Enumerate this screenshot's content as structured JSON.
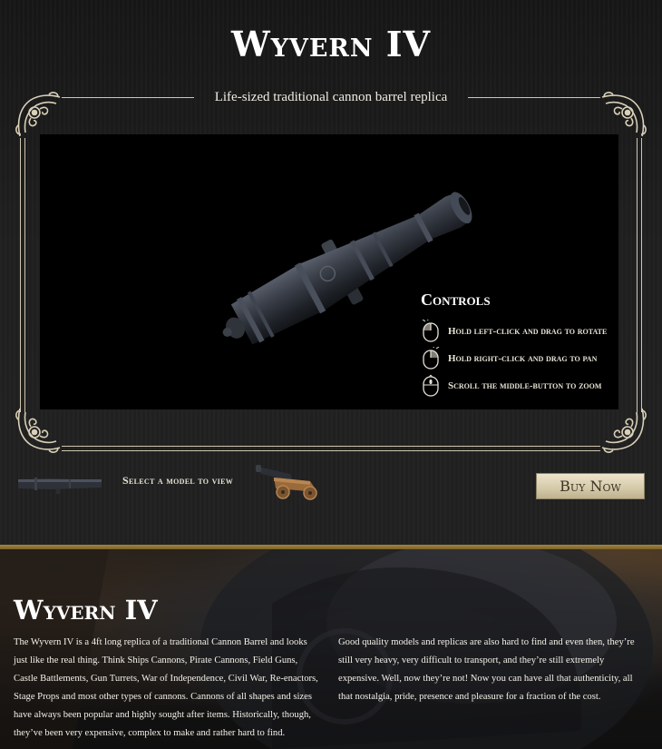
{
  "header": {
    "title": "Wyvern IV",
    "subtitle": "Life-sized traditional cannon barrel replica"
  },
  "viewer": {
    "controls_title": "Controls",
    "controls": [
      {
        "icon": "mouse-left-click-icon",
        "label": "Hold left-click and drag to rotate"
      },
      {
        "icon": "mouse-right-click-icon",
        "label": "Hold right-click and drag to pan"
      },
      {
        "icon": "mouse-scroll-icon",
        "label": "Scroll the middle-button to zoom"
      }
    ]
  },
  "model_selector": {
    "label": "Select a model to view",
    "models": [
      {
        "name": "cannon-barrel-thumbnail"
      },
      {
        "name": "cannon-carriage-thumbnail"
      }
    ]
  },
  "buy_button": {
    "label": "Buy Now"
  },
  "description": {
    "title": "Wyvern IV",
    "paragraph_1": "The Wyvern IV is a 4ft long replica of a traditional Cannon Barrel and looks just like the real thing. Think Ships Cannons, Pirate Cannons, Field Guns, Castle Battlements, Gun Turrets, War of Independence, Civil War, Re-enactors, Stage Props and most other types of cannons. Cannons of all shapes and sizes have always been popular and highly sought after items. Historically, though, they’ve been very expensive, complex to make and rather hard to find.",
    "paragraph_2": "Good quality models and replicas are also hard to find and even then, they’re still very heavy, very difficult to transport, and they’re still extremely expensive. Well, now they’re not! Now you can have all that authenticity, all that nostalgia, pride, presence and pleasure for a fraction of the cost."
  },
  "colors": {
    "gold_accent": "#a08442",
    "button_bg": "#d6cbab",
    "frame_line": "#cfc6ae",
    "viewer_bg": "#000000"
  }
}
